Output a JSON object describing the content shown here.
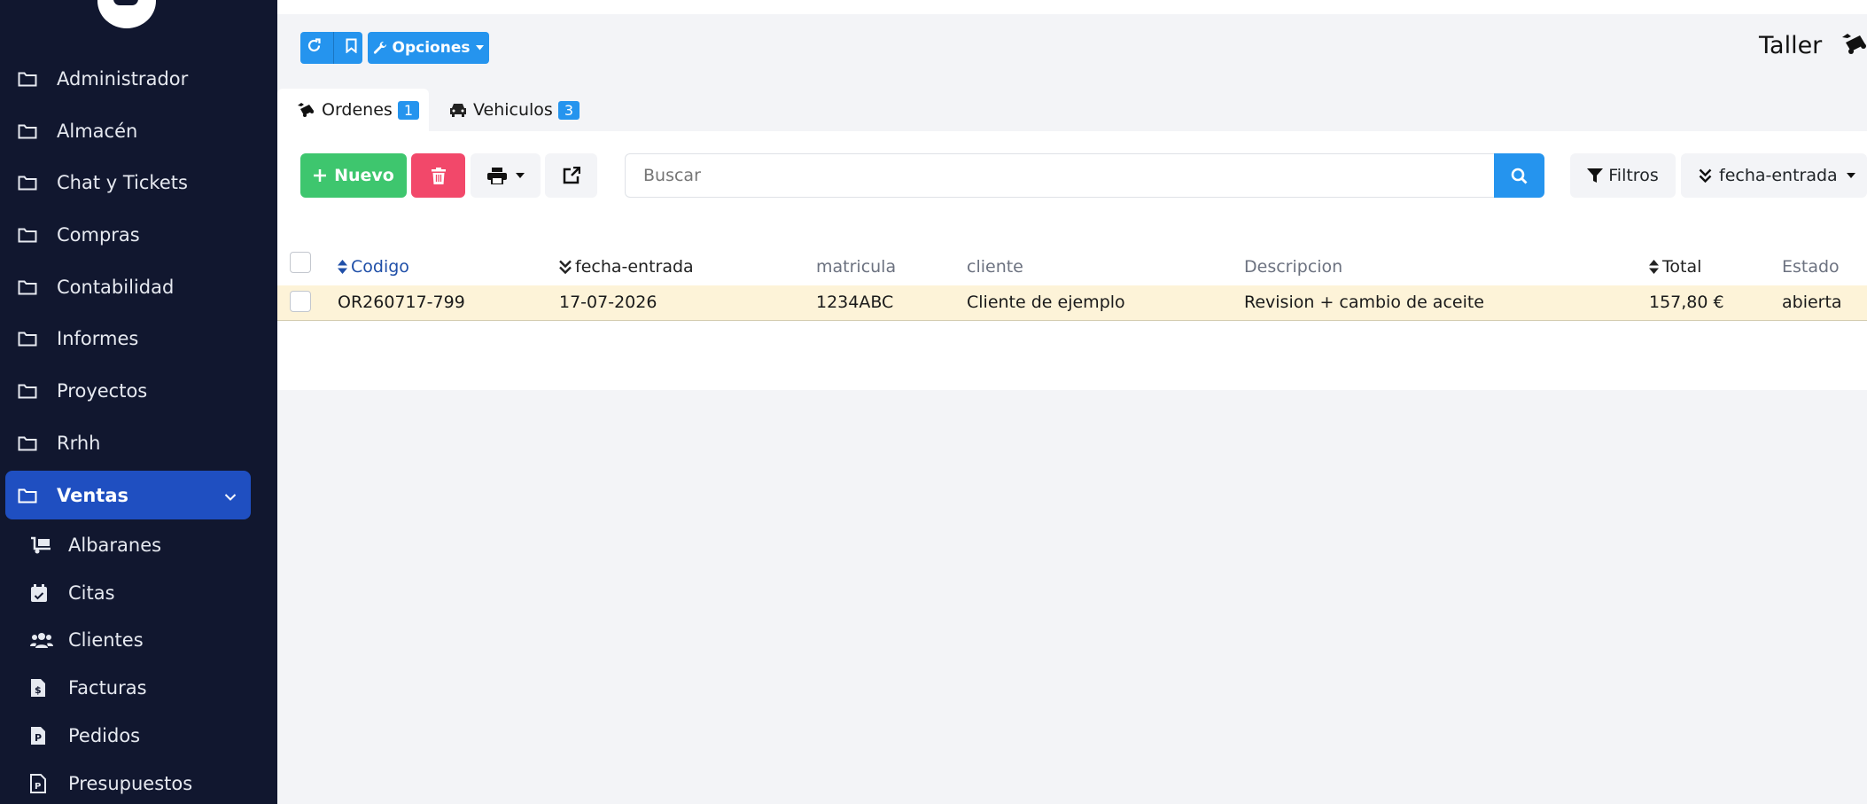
{
  "sidebar": {
    "items": [
      {
        "label": "Administrador"
      },
      {
        "label": "Almacén"
      },
      {
        "label": "Chat y Tickets"
      },
      {
        "label": "Compras"
      },
      {
        "label": "Contabilidad"
      },
      {
        "label": "Informes"
      },
      {
        "label": "Proyectos"
      },
      {
        "label": "Rrhh"
      },
      {
        "label": "Ventas"
      }
    ],
    "subitems": [
      {
        "label": "Albaranes"
      },
      {
        "label": "Citas"
      },
      {
        "label": "Clientes"
      },
      {
        "label": "Facturas"
      },
      {
        "label": "Pedidos"
      },
      {
        "label": "Presupuestos"
      }
    ]
  },
  "toolbar_top": {
    "options_label": "Opciones"
  },
  "page": {
    "title": "Taller"
  },
  "tabs": [
    {
      "label": "Ordenes",
      "count": "1"
    },
    {
      "label": "Vehiculos",
      "count": "3"
    }
  ],
  "actions": {
    "new_label": "Nuevo",
    "search_placeholder": "Buscar",
    "filters_label": "Filtros",
    "sort_label": "fecha-entrada"
  },
  "table": {
    "headers": {
      "codigo": "Codigo",
      "fecha": "fecha-entrada",
      "matricula": "matricula",
      "cliente": "cliente",
      "descripcion": "Descripcion",
      "total": "Total",
      "estado": "Estado"
    },
    "rows": [
      {
        "codigo": "OR260717-799",
        "fecha": "17-07-2026",
        "matricula": "1234ABC",
        "cliente": "Cliente de ejemplo",
        "descripcion": "Revision + cambio de aceite",
        "total": "157,80 €",
        "estado": "abierta"
      }
    ]
  },
  "colors": {
    "sidebar_bg": "#11172f",
    "active_nav": "#1f4fc1",
    "primary": "#2594ee",
    "success": "#3ec66e",
    "danger": "#f2486a",
    "row_highlight": "#fdf3d8"
  }
}
